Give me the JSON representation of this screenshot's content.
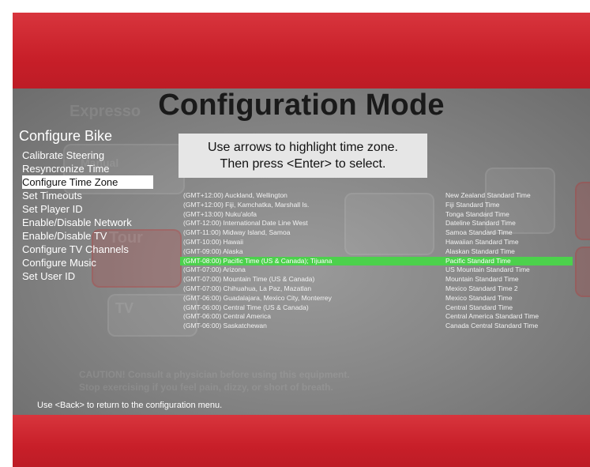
{
  "title": "Configuration Mode",
  "menu": {
    "heading": "Configure Bike",
    "items": [
      {
        "label": "Calibrate Steering",
        "selected": false
      },
      {
        "label": "Resyncronize Time",
        "selected": false
      },
      {
        "label": "Configure Time Zone",
        "selected": true
      },
      {
        "label": "Set Timeouts",
        "selected": false
      },
      {
        "label": "Set Player ID",
        "selected": false
      },
      {
        "label": "Enable/Disable Network",
        "selected": false
      },
      {
        "label": "Enable/Disable TV",
        "selected": false
      },
      {
        "label": "Configure TV Channels",
        "selected": false
      },
      {
        "label": "Configure Music",
        "selected": false
      },
      {
        "label": "Set User ID",
        "selected": false
      }
    ]
  },
  "instruction": {
    "line1": "Use arrows to highlight time zone.",
    "line2": "Then press <Enter> to select."
  },
  "timezones": [
    {
      "name": "(GMT+12:00) Auckland, Wellington",
      "standard": "New Zealand Standard Time",
      "selected": false
    },
    {
      "name": "(GMT+12:00) Fiji, Kamchatka, Marshall Is.",
      "standard": "Fiji Standard Time",
      "selected": false
    },
    {
      "name": "(GMT+13:00) Nuku'alofa",
      "standard": "Tonga Standard Time",
      "selected": false
    },
    {
      "name": "(GMT-12:00) International Date Line West",
      "standard": "Dateline Standard Time",
      "selected": false
    },
    {
      "name": "(GMT-11:00) Midway Island, Samoa",
      "standard": "Samoa Standard Time",
      "selected": false
    },
    {
      "name": "(GMT-10:00) Hawaii",
      "standard": "Hawaiian Standard Time",
      "selected": false
    },
    {
      "name": "(GMT-09:00) Alaska",
      "standard": "Alaskan Standard Time",
      "selected": false
    },
    {
      "name": "(GMT-08:00) Pacific Time (US & Canada); Tijuana",
      "standard": "Pacific Standard Time",
      "selected": true
    },
    {
      "name": "(GMT-07:00) Arizona",
      "standard": "US Mountain Standard Time",
      "selected": false
    },
    {
      "name": "(GMT-07:00) Mountain Time (US & Canada)",
      "standard": "Mountain Standard Time",
      "selected": false
    },
    {
      "name": "(GMT-07:00) Chihuahua, La Paz, Mazatlan",
      "standard": "Mexico Standard Time 2",
      "selected": false
    },
    {
      "name": "(GMT-06:00) Guadalajara, Mexico City, Monterrey",
      "standard": "Mexico Standard Time",
      "selected": false
    },
    {
      "name": "(GMT-06:00) Central Time (US & Canada)",
      "standard": "Central Standard Time",
      "selected": false
    },
    {
      "name": "(GMT-06:00) Central America",
      "standard": "Central America Standard Time",
      "selected": false
    },
    {
      "name": "(GMT-06:00) Saskatchewan",
      "standard": "Canada Central Standard Time",
      "selected": false
    }
  ],
  "background_watermark": {
    "brand": "Expresso",
    "manual": "Manual",
    "tour": "Tour",
    "tv": "TV",
    "caution_line1": "CAUTION! Consult a physician before using this equipment.",
    "caution_line2": "Stop exercising if you feel pain, dizzy, or short of breath."
  },
  "footer_hint": "Use <Back> to return to the configuration menu.",
  "colors": {
    "brand_red": "#c81f29",
    "highlight_green": "#4cd14c",
    "panel_gray": "#878787"
  }
}
